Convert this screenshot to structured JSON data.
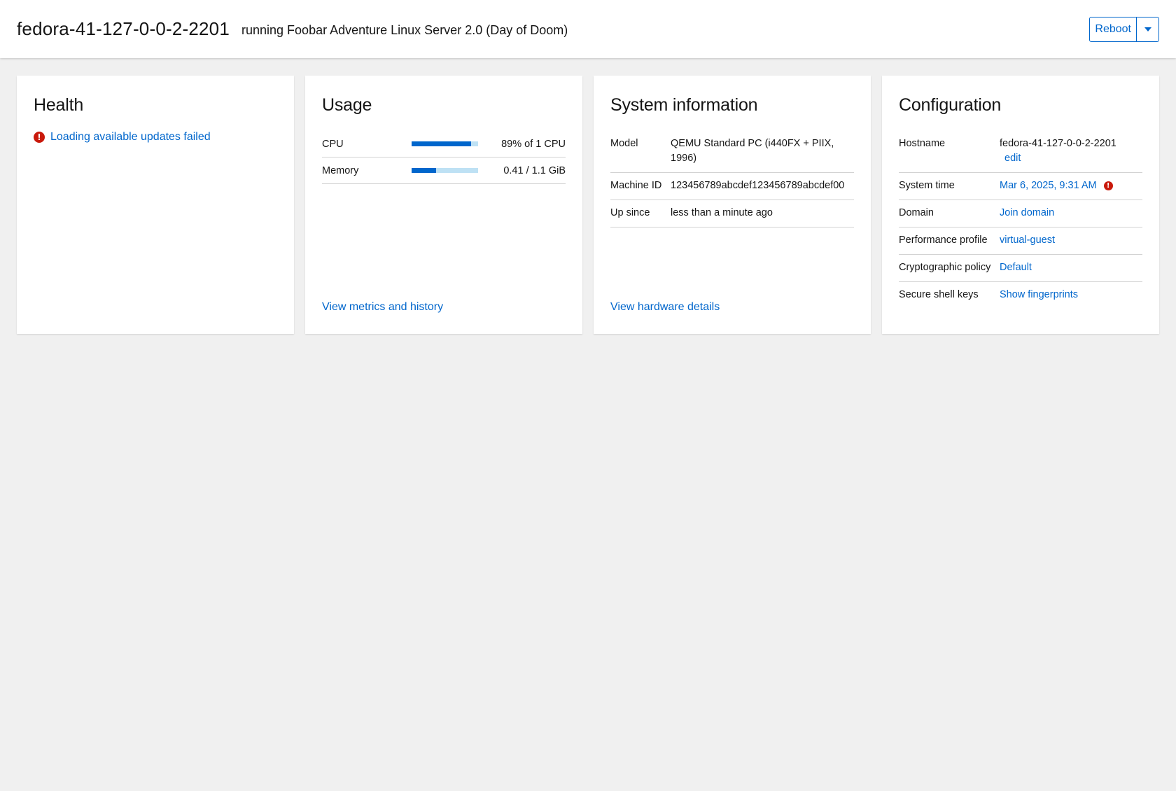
{
  "header": {
    "hostname": "fedora-41-127-0-0-2-2201",
    "os": "running Foobar Adventure Linux Server 2.0 (Day of Doom)",
    "reboot_label": "Reboot"
  },
  "health": {
    "title": "Health",
    "items": [
      {
        "label": "Loading available updates failed",
        "status": "error"
      }
    ]
  },
  "usage": {
    "title": "Usage",
    "rows": [
      {
        "label": "CPU",
        "value": "89% of 1 CPU",
        "fraction": 0.89
      },
      {
        "label": "Memory",
        "value": "0.41 / 1.1 GiB",
        "fraction": 0.37
      }
    ],
    "link": "View metrics and history"
  },
  "system_info": {
    "title": "System information",
    "rows": [
      {
        "key": "Model",
        "value": "QEMU Standard PC (i440FX + PIIX, 1996)"
      },
      {
        "key": "Machine ID",
        "value": "123456789abcdef123456789abcdef00"
      },
      {
        "key": "Up since",
        "value": "less than a minute ago"
      }
    ],
    "link": "View hardware details"
  },
  "configuration": {
    "title": "Configuration",
    "hostname": {
      "key": "Hostname",
      "value": "fedora-41-127-0-0-2-2201",
      "edit": "edit"
    },
    "system_time": {
      "key": "System time",
      "value": "Mar 6, 2025, 9:31 AM"
    },
    "domain": {
      "key": "Domain",
      "value": "Join domain"
    },
    "performance": {
      "key": "Performance profile",
      "value": "virtual-guest"
    },
    "crypto": {
      "key": "Cryptographic policy",
      "value": "Default"
    },
    "ssh": {
      "key": "Secure shell keys",
      "value": "Show fingerprints"
    }
  },
  "colors": {
    "accent": "#0066cc",
    "error": "#c9190b",
    "bar_track": "#bee1f4",
    "background": "#f0f0f0"
  },
  "icons": {
    "error": "exclamation-circle-icon",
    "dropdown": "caret-down-icon"
  }
}
